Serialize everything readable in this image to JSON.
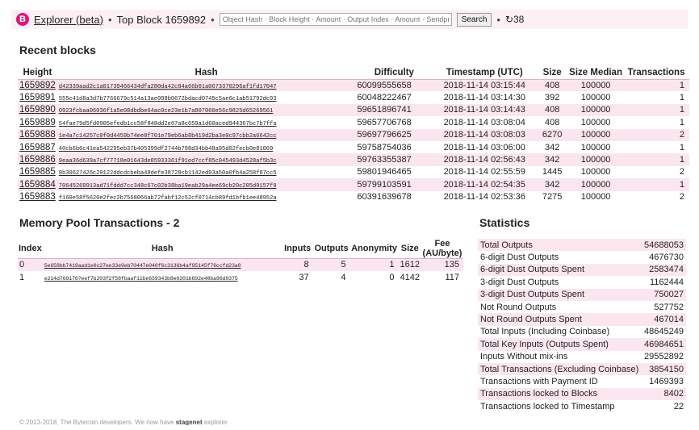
{
  "topbar": {
    "logo": "B",
    "brand": "Explorer (beta)",
    "top_block_label": "Top Block 1659892",
    "search_placeholder": "Object Hash · Block Height · Amount · Output Index · Amount · Sendproof",
    "search_button": "Search",
    "refresh_label": "↻38",
    "separator": "•"
  },
  "recent_blocks": {
    "title": "Recent blocks",
    "columns": [
      "Height",
      "Hash",
      "Difficulty",
      "Timestamp (UTC)",
      "Size",
      "Size Median",
      "Transactions"
    ],
    "rows": [
      {
        "height": "1659892",
        "hash": "d42339aad2c1a01739466434dfa280da42c84a66b01a0673370296af1fd17047",
        "difficulty": "60099555658",
        "timestamp": "2018-11-14 03:15:44",
        "size": "408",
        "median": "100000",
        "txs": "1"
      },
      {
        "height": "1659891",
        "hash": "555c41d8a3d7b7766679c514a13ae098b0672bdacd0745c5ae6c1ab51792dc93",
        "difficulty": "60048222467",
        "timestamp": "2018-11-14 03:14:30",
        "size": "392",
        "median": "100000",
        "txs": "1"
      },
      {
        "height": "1659890",
        "hash": "0923fcbaa06036f1a5e08dbdbe64ac0ce23e1b7a807060e56c9825d65269561",
        "difficulty": "59651896741",
        "timestamp": "2018-11-14 03:14:43",
        "size": "408",
        "median": "100000",
        "txs": "1"
      },
      {
        "height": "1659889",
        "hash": "54fae79d5fd0905efedb1cc58f848dd2e67a8c659a1d60aced944367bc7b7ffa",
        "difficulty": "59657706768",
        "timestamp": "2018-11-14 03:08:04",
        "size": "408",
        "median": "100000",
        "txs": "1"
      },
      {
        "height": "1659888",
        "hash": "1e4a7c14257c0f0d4459b74ee8f701e79eb6ab8b419d2ba3e0c97cbb2a6642cc",
        "difficulty": "59697796625",
        "timestamp": "2018-11-14 03:08:03",
        "size": "6270",
        "median": "100000",
        "txs": "2"
      },
      {
        "height": "1659887",
        "hash": "40cb6b6c41ea542295eb37b405399df2744b798d34bb48a95d02fecb0e81069",
        "difficulty": "59758754036",
        "timestamp": "2018-11-14 03:06:00",
        "size": "342",
        "median": "100000",
        "txs": "1"
      },
      {
        "height": "1659886",
        "hash": "9eaa36d639a7cf77718e01643de85933361f91ed7ccf85c045493d4528af5b3c",
        "difficulty": "59763355387",
        "timestamp": "2018-11-14 02:56:43",
        "size": "342",
        "median": "100000",
        "txs": "1"
      },
      {
        "height": "1659885",
        "hash": "8b30627426c20122ddcdcbeba48defe38728cb1142ed93a50a0fb4a258f87cc5",
        "difficulty": "59801946465",
        "timestamp": "2018-11-14 02:55:59",
        "size": "1445",
        "median": "100000",
        "txs": "2"
      },
      {
        "height": "1659884",
        "hash": "70645269913ad71fddd7cc348c67c02b38ba19eab29a4ee69cb20c205d9157f9",
        "difficulty": "59799103591",
        "timestamp": "2018-11-14 02:54:35",
        "size": "342",
        "median": "100000",
        "txs": "1"
      },
      {
        "height": "1659883",
        "hash": "f160e58f5620e2fec2b7568066ab72fabf12c52cf0714cb89fd1bfb1ee48952a",
        "difficulty": "60391639678",
        "timestamp": "2018-11-14 02:53:36",
        "size": "7275",
        "median": "100000",
        "txs": "2"
      }
    ]
  },
  "mempool": {
    "title": "Memory Pool Transactions - 2",
    "columns": [
      "Index",
      "Hash",
      "Inputs",
      "Outputs",
      "Anonymity",
      "Size",
      "Fee (AU/byte)"
    ],
    "rows": [
      {
        "index": "0",
        "hash": "5e658bb7419aad1e0c27ee33e9eb70447e040f6c3136b4af95145f76ccfd23a0",
        "inputs": "8",
        "outputs": "5",
        "anonymity": "1",
        "size": "1612",
        "fee": "135"
      },
      {
        "index": "1",
        "hash": "e214d769176?eef7b203f2f58fbaaf11be659343b8e0201b692e40ba96d9375",
        "inputs": "37",
        "outputs": "4",
        "anonymity": "0",
        "size": "4142",
        "fee": "117"
      }
    ]
  },
  "statistics": {
    "title": "Statistics",
    "rows": [
      {
        "label": "Total Outputs",
        "value": "54688053"
      },
      {
        "label": "6-digit Dust Outputs",
        "value": "4676730"
      },
      {
        "label": "6-digit Dust Outputs Spent",
        "value": "2583474"
      },
      {
        "label": "3-digit Dust Outputs",
        "value": "1162444"
      },
      {
        "label": "3-digit Dust Outputs Spent",
        "value": "750027"
      },
      {
        "label": "Not Round Outputs",
        "value": "527752"
      },
      {
        "label": "Not Round Outputs Spent",
        "value": "467014"
      },
      {
        "label": "Total Inputs (Including Coinbase)",
        "value": "48645249"
      },
      {
        "label": "Total Key Inputs (Outputs Spent)",
        "value": "46984651"
      },
      {
        "label": "Inputs Without mix-ins",
        "value": "29552892"
      },
      {
        "label": "Total Transactions (Excluding Coinbase)",
        "value": "3854150"
      },
      {
        "label": "Transactions with Payment ID",
        "value": "1469393"
      },
      {
        "label": "Transactions locked to Blocks",
        "value": "8402"
      },
      {
        "label": "Transactions locked to Timestamp",
        "value": "22"
      }
    ]
  },
  "footer": {
    "text": "© 2013-2018, The Bytecoin developers. We now have ",
    "link": "stagenet",
    "suffix": " explorer"
  },
  "colors": {
    "accent": "#e0157a",
    "row_stripe": "#fbe6ef",
    "topbar_bg": "#fdf0f5"
  }
}
